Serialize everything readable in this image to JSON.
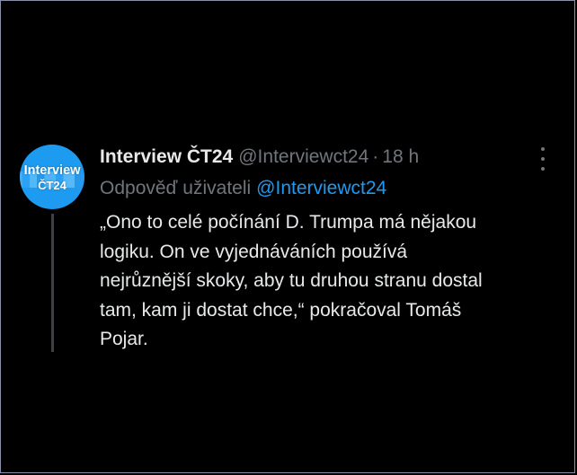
{
  "tweet": {
    "avatar": {
      "line1": "Interview",
      "line2": "ČT24",
      "color": "#1d9bf0"
    },
    "display_name": "Interview ČT24",
    "handle": "@Interviewct24",
    "separator": "·",
    "time": "18 h",
    "more_icon": "more-vertical-icon",
    "reply_label": "Odpověď uživateli",
    "reply_to": "@Interviewct24",
    "text_lines": [
      "„Ono to celé počínání D. Trumpa má nějakou",
      "logiku. On ve vyjednáváních používá",
      "nejrůznější skoky, aby tu druhou stranu dostal",
      "tam, kam ji dostat chce,“ pokračoval Tomáš",
      "Pojar."
    ]
  },
  "colors": {
    "background": "#000000",
    "primary_text": "#e7e9ea",
    "secondary_text": "#71767b",
    "link": "#1d9bf0",
    "thread_line": "#3e4144"
  }
}
